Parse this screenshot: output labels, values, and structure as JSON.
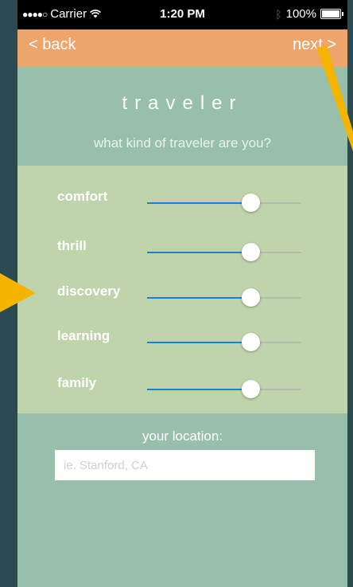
{
  "status_bar": {
    "carrier": "Carrier",
    "time": "1:20 PM",
    "battery": "100%",
    "battery_level": 1.0
  },
  "nav": {
    "back_label": "< back",
    "next_label": "next >"
  },
  "header": {
    "title": "traveler",
    "subtitle": "what kind of traveler are you?"
  },
  "sliders": [
    {
      "label": "comfort",
      "value": 0.67
    },
    {
      "label": "thrill",
      "value": 0.67
    },
    {
      "label": "discovery",
      "value": 0.67
    },
    {
      "label": "learning",
      "value": 0.67
    },
    {
      "label": "family",
      "value": 0.67
    }
  ],
  "location": {
    "label": "your location:",
    "placeholder": "ie. Stanford, CA",
    "value": ""
  },
  "colors": {
    "background": "#2c4a52",
    "screen": "#97bfac",
    "nav": "#eda56c",
    "panel": "#c0d4ac",
    "slider_fill": "#1a7fd6",
    "annotation_arrow": "#f5b400"
  }
}
